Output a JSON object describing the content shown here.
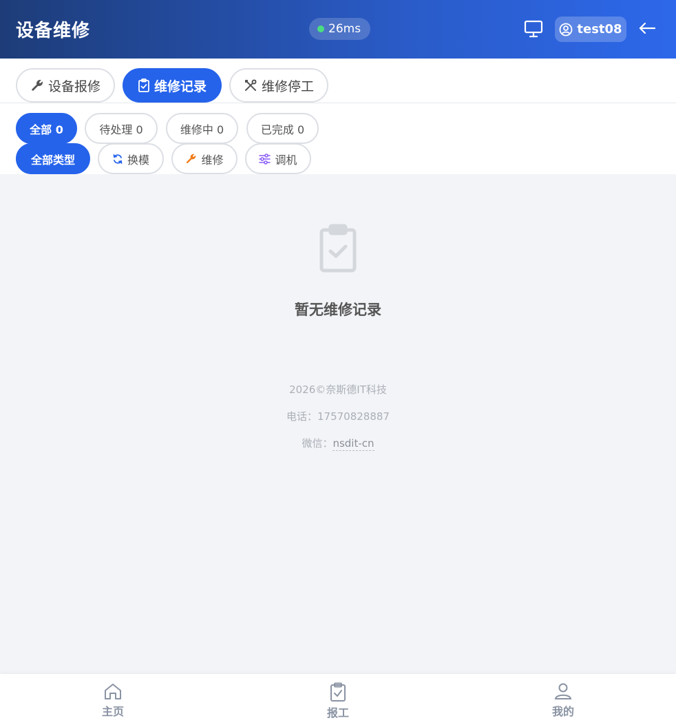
{
  "header": {
    "title": "设备维修",
    "latency": "26ms",
    "user": "test08"
  },
  "main_tabs": [
    {
      "label": "设备报修",
      "icon": "wrench-icon",
      "active": false
    },
    {
      "label": "维修记录",
      "icon": "clipboard-check-icon",
      "active": true
    },
    {
      "label": "维修停工",
      "icon": "tools-icon",
      "active": false
    }
  ],
  "status_filters": [
    {
      "label": "全部 0",
      "active": true
    },
    {
      "label": "待处理 0",
      "active": false
    },
    {
      "label": "维修中 0",
      "active": false
    },
    {
      "label": "已完成 0",
      "active": false
    }
  ],
  "type_filters": [
    {
      "label": "全部类型",
      "icon": null,
      "active": true
    },
    {
      "label": "换模",
      "icon": "refresh-icon",
      "active": false
    },
    {
      "label": "维修",
      "icon": "wrench-icon",
      "active": false
    },
    {
      "label": "调机",
      "icon": "sliders-icon",
      "active": false
    }
  ],
  "empty": {
    "icon": "clipboard-check-icon",
    "text": "暂无维修记录"
  },
  "footer": {
    "copyright": "2026©奈斯德IT科技",
    "phone": "电话：17570828887",
    "wechat_label": "微信：",
    "wechat_value": "nsdit-cn"
  },
  "bottom_nav": [
    {
      "label": "主页",
      "icon": "home-icon"
    },
    {
      "label": "报工",
      "icon": "clipboard-check-icon"
    },
    {
      "label": "我的",
      "icon": "user-icon"
    }
  ],
  "colors": {
    "accent": "#2563eb",
    "header_start": "#1d3c78",
    "header_end": "#2d68ea",
    "online": "#4ade80",
    "wrench_orange": "#f07d1a",
    "sliders_purple": "#8b5cf6",
    "refresh_blue": "#2563eb"
  }
}
